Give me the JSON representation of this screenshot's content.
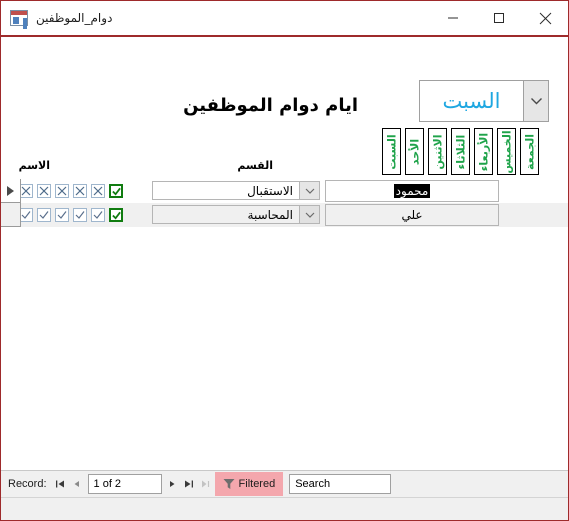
{
  "window": {
    "title": "دوام_الموظفين",
    "icon": "access-form-icon",
    "border_color": "#9e2a2b",
    "minimize_label": "−",
    "maximize_label": "□",
    "close_label": "✕"
  },
  "form": {
    "heading": "ايام دوام الموظفين",
    "day_selector": {
      "selected": "السبت",
      "text_color": "#1ea7e1",
      "dropdown_icon": "chevron-down-icon"
    },
    "day_headers": [
      "الجمعة",
      "الخميس",
      "الأربعاء",
      "الثلاثاء",
      "الاثنين",
      "الأحد",
      "السبت"
    ],
    "day_header_color": "#1fa34a",
    "columns": {
      "name": "الاسم",
      "department": "القسم"
    },
    "rows": [
      {
        "selected": true,
        "name": "محمود",
        "name_selected": true,
        "department": "الاستقبال",
        "checks": [
          "check",
          "x",
          "x",
          "x",
          "x",
          "x",
          "x"
        ],
        "focused_check_index": 0
      },
      {
        "selected": false,
        "name": "علي",
        "name_selected": false,
        "department": "المحاسبة",
        "checks": [
          "check",
          "check",
          "check",
          "check",
          "check",
          "check",
          "x"
        ],
        "focused_check_index": 0
      }
    ]
  },
  "navbar": {
    "record_label": "Record:",
    "first_icon": "first-record-icon",
    "prev_icon": "previous-record-icon",
    "position": "1 of 2",
    "next_icon": "next-record-icon",
    "last_icon": "last-record-icon",
    "new_icon": "new-record-icon",
    "filter_icon": "filter-icon",
    "filter_label": "Filtered",
    "filter_bg": "#f4a7ad",
    "search_placeholder": "Search",
    "search_value": "Search"
  }
}
